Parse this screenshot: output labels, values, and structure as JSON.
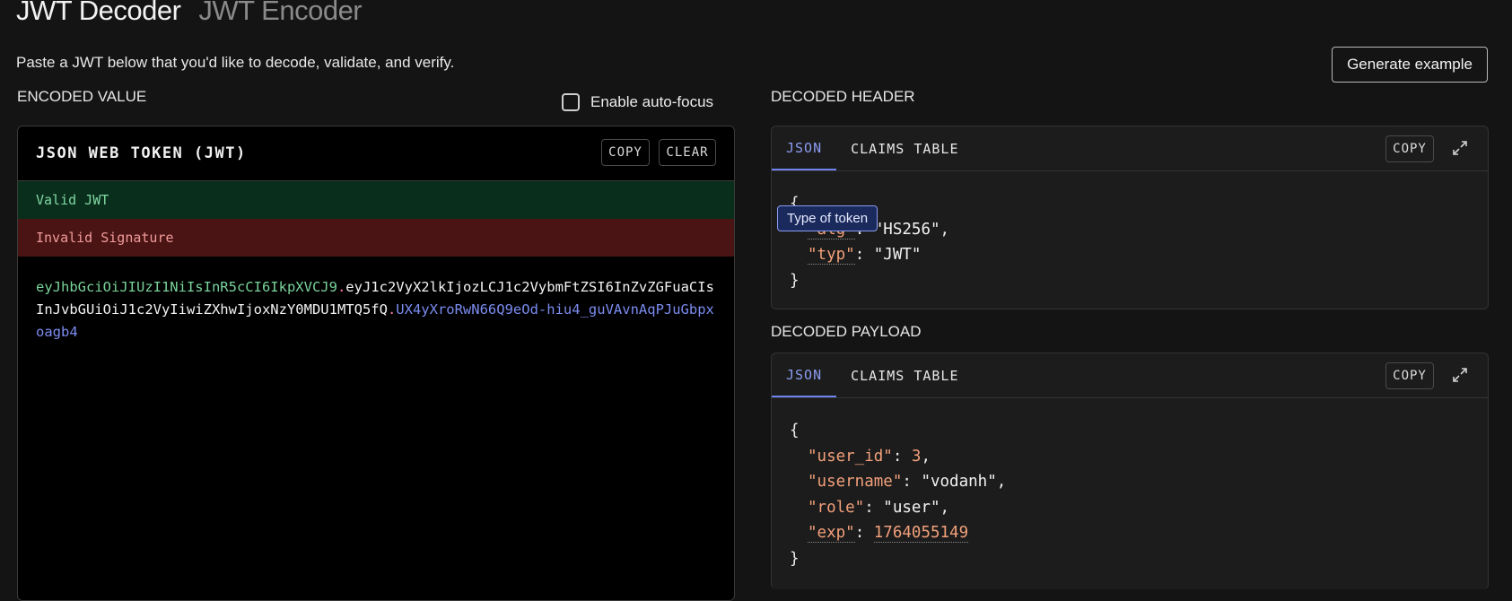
{
  "header": {
    "title_decoder": "JWT Decoder",
    "title_encoder": "JWT Encoder",
    "subtitle": "Paste a JWT below that you'd like to decode, validate, and verify.",
    "generate_button": "Generate example"
  },
  "encoded": {
    "section_label": "ENCODED VALUE",
    "autofocus_label": "Enable auto-focus",
    "autofocus_checked": false,
    "panel_title": "JSON WEB TOKEN (JWT)",
    "copy_label": "COPY",
    "clear_label": "CLEAR",
    "status_valid": "Valid JWT",
    "status_invalid": "Invalid Signature",
    "token_header": "eyJhbGciOiJIUzI1NiIsInR5cCI6IkpXVCJ9",
    "token_dot1": ".",
    "token_payload": "eyJ1c2VyX2lkIjozLCJ1c2VybmFtZSI6InZvZGFuaCIsInJvbGUiOiJ1c2VyIiwiZXhwIjoxNzY0MDU1MTQ5fQ",
    "token_dot2": ".",
    "token_signature": "UX4yXroRwN66Q9eOd-hiu4_guVAvnAqPJuGbpxoagb4",
    "colors": {
      "header": "#79d39a",
      "payload": "#f2f2f2",
      "signature": "#7b8cf0"
    }
  },
  "decoded_header": {
    "section_label": "DECODED HEADER",
    "tab_json": "JSON",
    "tab_claims": "CLAIMS TABLE",
    "copy_label": "COPY",
    "json": {
      "open": "{",
      "close": "}",
      "alg_key": "\"alg\"",
      "alg_value": "\"HS256\"",
      "typ_key": "\"typ\"",
      "typ_value": "\"JWT\""
    },
    "tooltip": "Type of token"
  },
  "decoded_payload": {
    "section_label": "DECODED PAYLOAD",
    "tab_json": "JSON",
    "tab_claims": "CLAIMS TABLE",
    "copy_label": "COPY",
    "json": {
      "open": "{",
      "close": "}",
      "user_id_key": "\"user_id\"",
      "user_id_value": "3",
      "username_key": "\"username\"",
      "username_value": "\"vodanh\"",
      "role_key": "\"role\"",
      "role_value": "\"user\"",
      "exp_key": "\"exp\"",
      "exp_value": "1764055149"
    }
  },
  "icons": {
    "expand": "expand-icon",
    "checkbox": "checkbox-icon"
  },
  "accent_color": "#8a9cf0"
}
